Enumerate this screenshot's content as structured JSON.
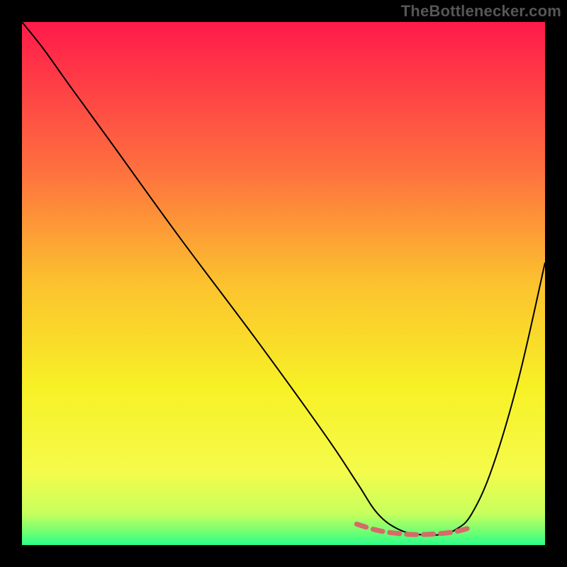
{
  "watermark": "TheBottlenecker.com",
  "chart_data": {
    "type": "line",
    "title": "",
    "xlabel": "",
    "ylabel": "",
    "xlim": [
      0,
      100
    ],
    "ylim": [
      0,
      100
    ],
    "grid": false,
    "background_gradient": {
      "type": "vertical",
      "stops": [
        {
          "offset": 0.0,
          "color": "#ff1a4a"
        },
        {
          "offset": 0.28,
          "color": "#fe6f3f"
        },
        {
          "offset": 0.5,
          "color": "#fcc22e"
        },
        {
          "offset": 0.7,
          "color": "#f7f126"
        },
        {
          "offset": 0.86,
          "color": "#f5fb4b"
        },
        {
          "offset": 0.94,
          "color": "#c7ff5d"
        },
        {
          "offset": 0.97,
          "color": "#7dff6f"
        },
        {
          "offset": 1.0,
          "color": "#2bff8a"
        }
      ]
    },
    "series": [
      {
        "name": "curve",
        "stroke": "#000000",
        "stroke_width": 2,
        "x": [
          0,
          4,
          9,
          17,
          30,
          45,
          58,
          64,
          68,
          72,
          76,
          80,
          83,
          86,
          90,
          95,
          100
        ],
        "y": [
          100,
          95,
          88,
          77,
          59,
          39,
          21,
          12,
          6,
          3,
          2,
          2,
          3,
          6,
          15,
          32,
          54
        ]
      },
      {
        "name": "highlight",
        "stroke": "#d46a6a",
        "stroke_width": 7,
        "stroke_dasharray": "14 10",
        "x": [
          64,
          68,
          72,
          76,
          80,
          83,
          86
        ],
        "y": [
          4.0,
          2.8,
          2.2,
          2.0,
          2.2,
          2.6,
          3.4
        ]
      }
    ]
  }
}
